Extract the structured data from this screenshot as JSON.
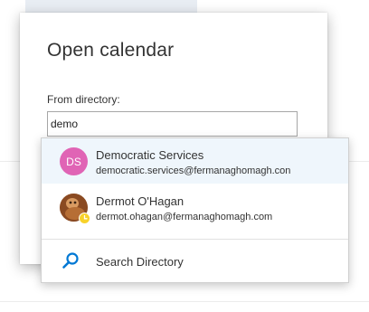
{
  "dialog": {
    "title": "Open calendar",
    "field_label": "From directory:",
    "input_value": "demo"
  },
  "suggestions": [
    {
      "name": "Democratic Services",
      "email": "democratic.services@fermanaghomagh.con",
      "avatar_initials": "DS",
      "avatar_color": "#e064b5",
      "selected": true
    },
    {
      "name": "Dermot O'Hagan",
      "email": "dermot.ohagan@fermanaghomagh.com",
      "avatar_icon": "profile-photo-icon",
      "presence": "away-clock-icon",
      "presence_color": "#f8d22a"
    }
  ],
  "search_directory": {
    "label": "Search Directory",
    "icon": "search-icon",
    "icon_color": "#0078d4"
  }
}
